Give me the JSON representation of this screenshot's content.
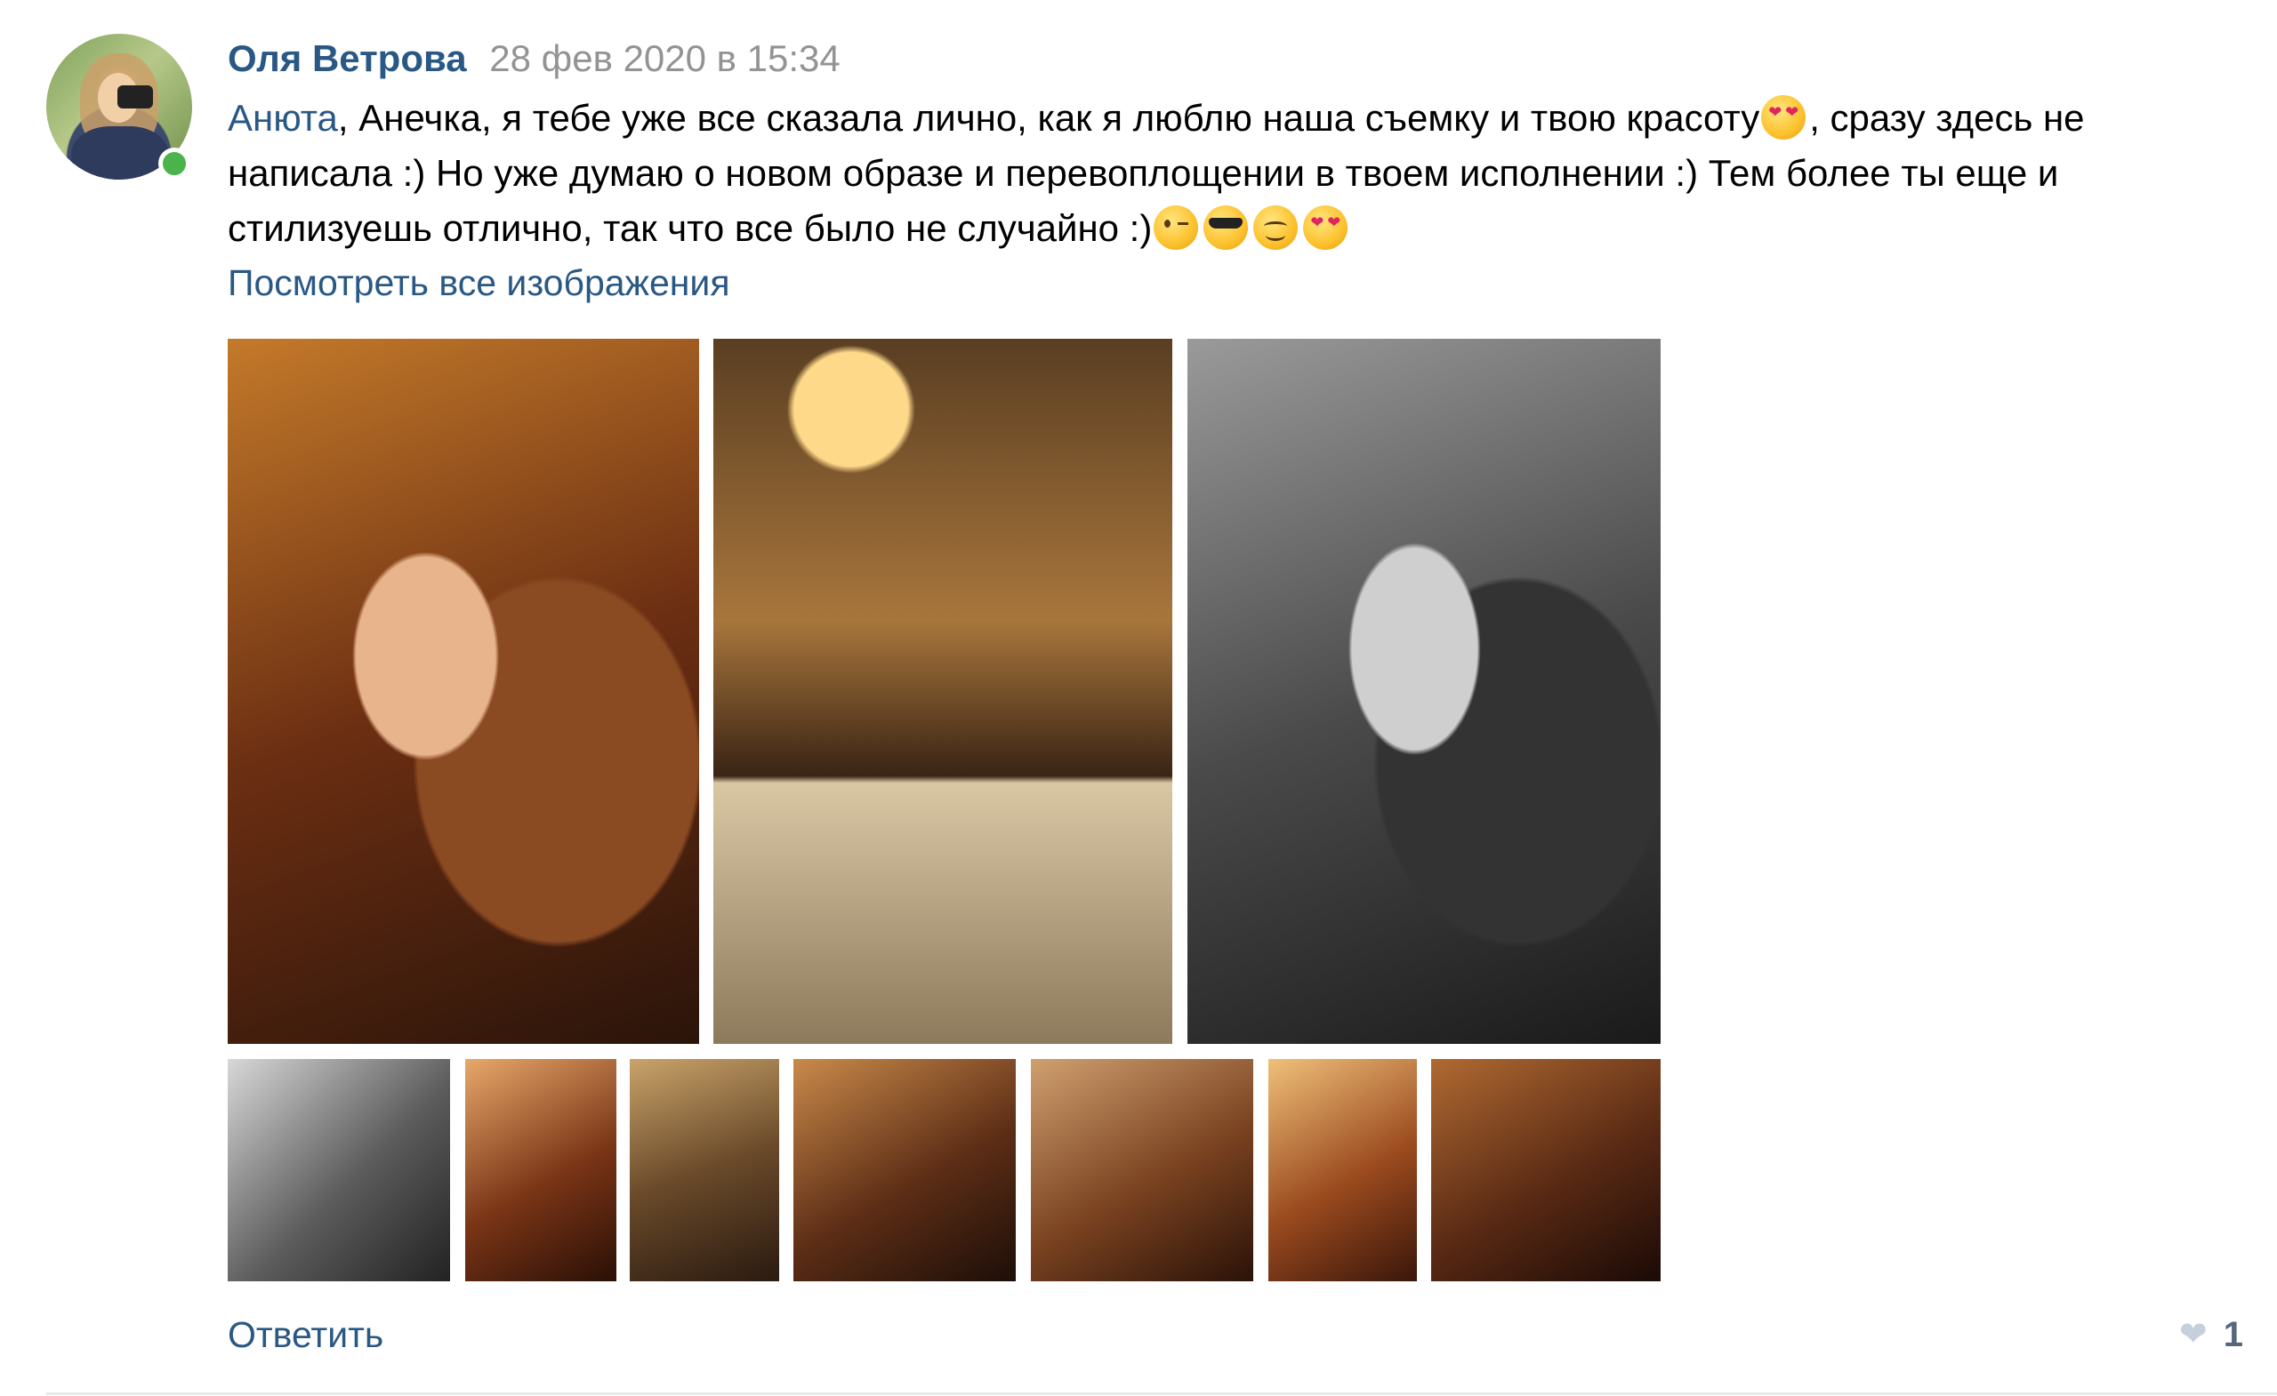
{
  "comment": {
    "author": "Оля Ветрова",
    "date": "28 фев 2020 в 15:34",
    "mention": "Анюта",
    "text_part1": ", Анечка, я тебе уже все сказала лично, как я люблю наша съемку и твою красоту",
    "text_part2": ", сразу здесь не написала :) Но уже думаю о новом образе и перевоплощении в твоем исполнении :) Тем более ты еще и стилизуешь отлично, так что все было не случайно :)",
    "view_all_label": "Посмотреть все изображения",
    "reply_label": "Ответить",
    "likes_count": "1"
  },
  "icons": {
    "avatar": "avatar",
    "online": "online-indicator",
    "like": "heart-icon",
    "emoji_inline": "heart-eyes-emoji",
    "emoji_tail": [
      "winking-face-emoji",
      "sunglasses-face-emoji",
      "smiling-face-emoji",
      "heart-eyes-emoji"
    ]
  },
  "colors": {
    "link": "#2a5885",
    "date": "#939393",
    "online": "#4bb34b",
    "like": "#c5d0db"
  },
  "photos": {
    "large_count": 3,
    "thumb_count": 7
  }
}
